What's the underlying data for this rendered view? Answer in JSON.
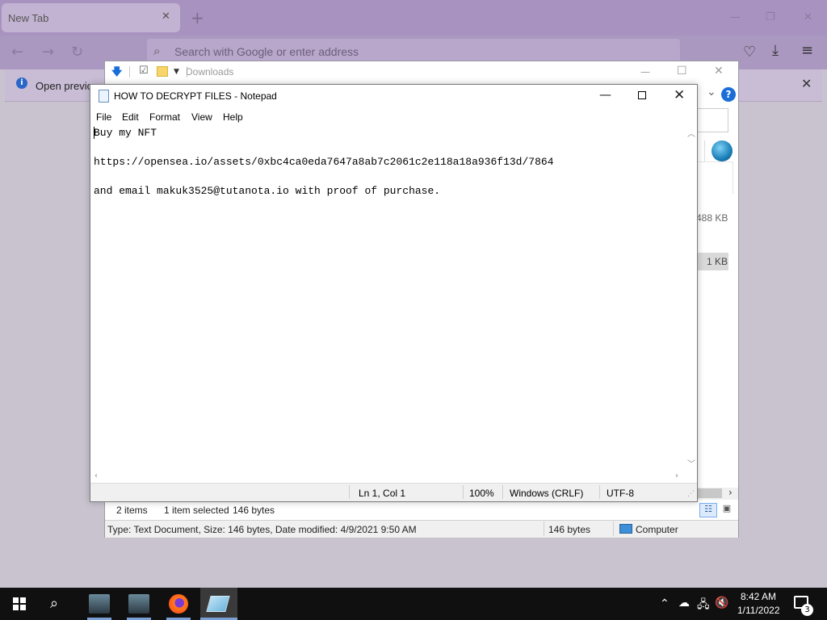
{
  "firefox": {
    "tab_title": "New Tab",
    "tab_close": "✕",
    "new_tab": "+",
    "url_placeholder": "Search with Google or enter address",
    "notification_text": "Open previo",
    "notification_close": "✕",
    "nav": {
      "back": "←",
      "forward": "→",
      "reload": "↻",
      "pocket": "♡",
      "downloads": "⤓",
      "menu": "≡"
    },
    "window": {
      "min": "—",
      "max": "❐",
      "close": "✕"
    }
  },
  "explorer": {
    "title": "Downloads",
    "window": {
      "min": "—",
      "max": "☐",
      "close": "✕"
    },
    "help": "?",
    "chevron": "⌄",
    "file_sizes": [
      "488 KB",
      "1 KB"
    ],
    "status": {
      "items": "2 items",
      "selected": "1 item selected",
      "bytes": "146 bytes"
    },
    "details": {
      "info": "Type: Text Document, Size: 146 bytes, Date modified: 4/9/2021 9:50 AM",
      "size": "146 bytes",
      "location": "Computer"
    }
  },
  "notepad": {
    "title": "HOW TO DECRYPT FILES - Notepad",
    "menu": [
      "File",
      "Edit",
      "Format",
      "View",
      "Help"
    ],
    "content": [
      "Buy my NFT",
      "",
      "https://opensea.io/assets/0xbc4ca0eda7647a8ab7c2061c2e118a18a936f13d/7864",
      "",
      "and email makuk3525@tutanota.io with proof of purchase."
    ],
    "status": {
      "position": "Ln 1, Col 1",
      "zoom": "100%",
      "line_ending": "Windows (CRLF)",
      "encoding": "UTF-8"
    }
  },
  "taskbar": {
    "time": "8:42 AM",
    "date": "1/11/2022",
    "notification_count": "3",
    "tray": {
      "chevron": "⌃",
      "sound": "🔇"
    }
  }
}
